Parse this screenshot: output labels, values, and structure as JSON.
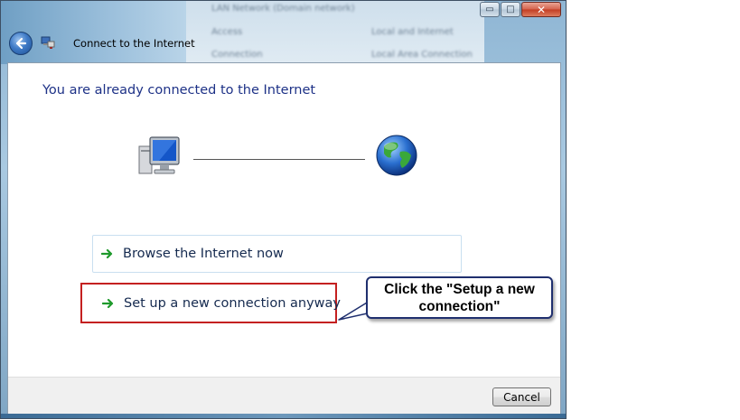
{
  "window": {
    "title": "Connect to the Internet",
    "background_text": {
      "network_name": "LAN Network (Domain network)",
      "row1_label": "Access",
      "row1_value": "Local and Internet",
      "row2_label": "Connection",
      "row2_value": "Local Area Connection"
    }
  },
  "caption_buttons": {
    "minimize": "▭",
    "maximize": "□",
    "close": "✕"
  },
  "content": {
    "headline": "You are already connected to the Internet",
    "icons": {
      "computer": "computer-icon",
      "globe": "globe-icon",
      "arrow": "green-arrow-icon"
    },
    "options": {
      "browse_label": "Browse the Internet now",
      "setup_label": "Set up a new connection anyway"
    }
  },
  "callout": {
    "text": "Click the \"Setup a new connection\""
  },
  "footer": {
    "cancel_label": "Cancel"
  },
  "colors": {
    "headline": "#1e3287",
    "highlight_border": "#c42020",
    "callout_border": "#1f2f6e",
    "arrow": "#1f9a2c"
  }
}
